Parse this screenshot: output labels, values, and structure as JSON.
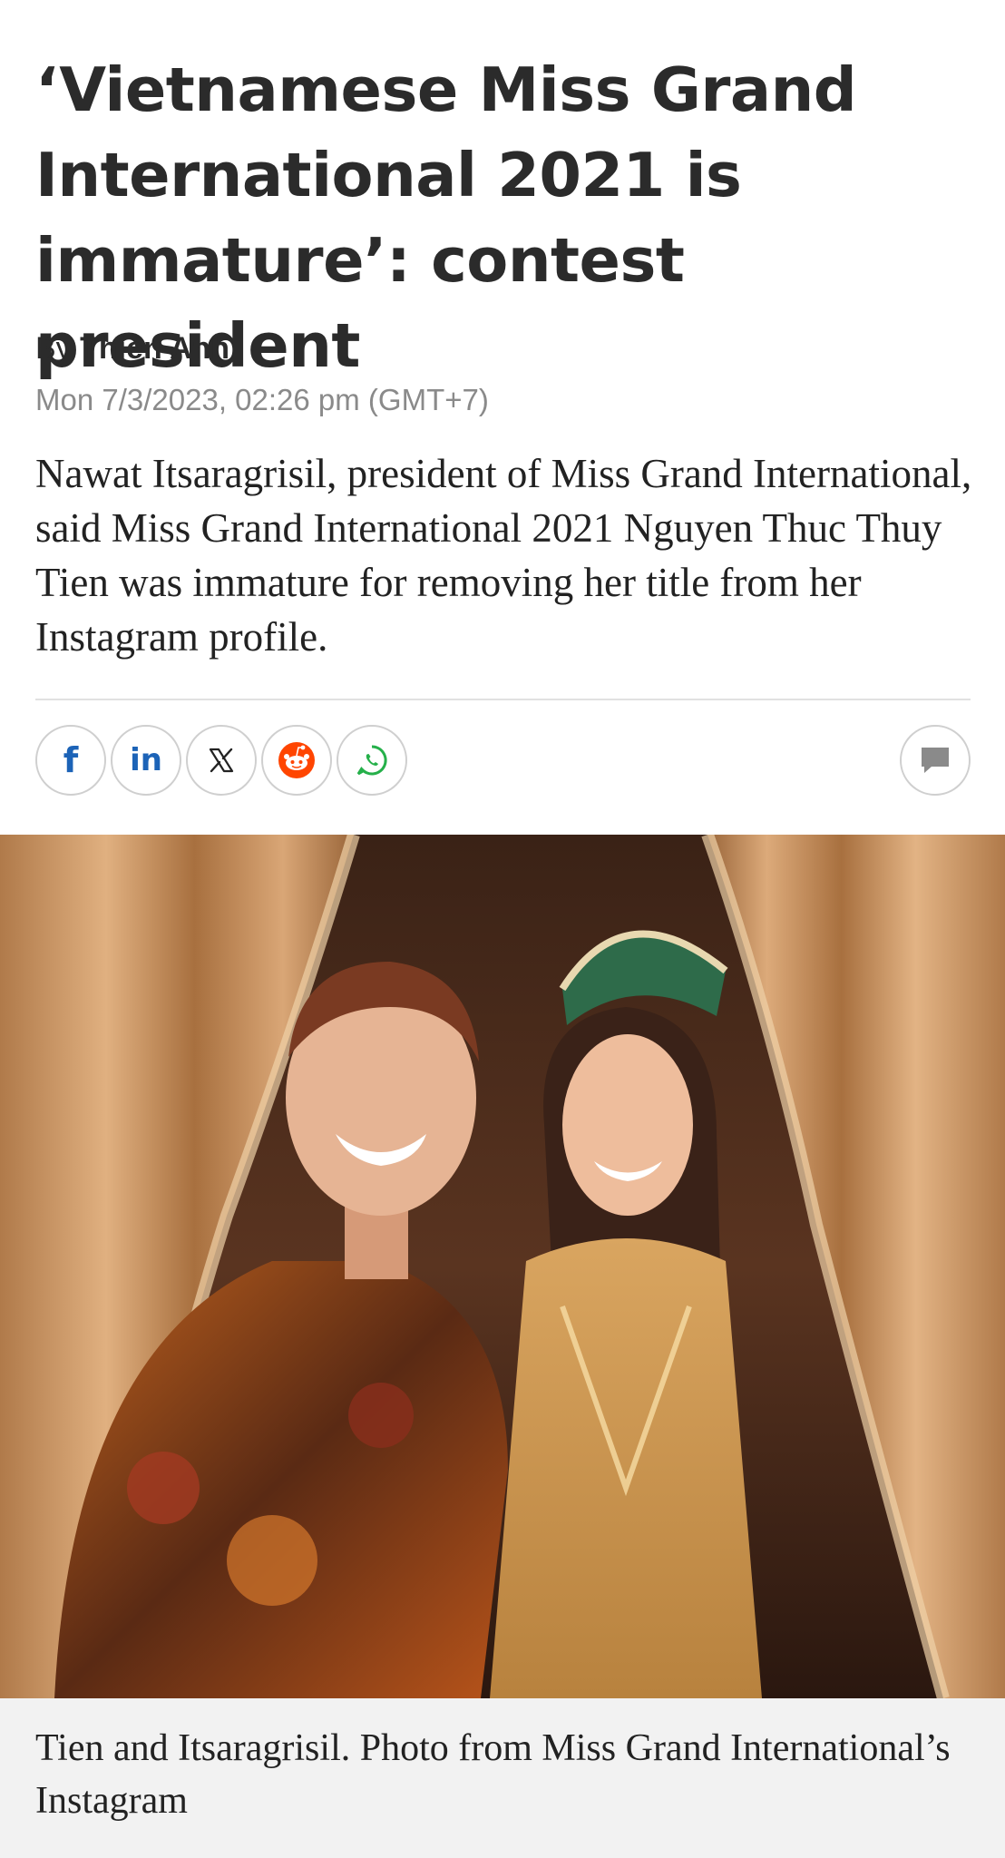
{
  "article": {
    "headline": "‘Vietnamese Miss Grand International 2021 is immature’: contest president",
    "byline_prefix": "By",
    "author": "Thien Anh",
    "timestamp": "Mon 7/3/2023, 02:26 pm (GMT+7)",
    "lead": "Nawat Itsaragrisil, president of Miss Grand International, said Miss Grand International 2021 Nguyen Thuc Thuy Tien was immature for removing her title from her Instagram profile."
  },
  "share": {
    "icons": [
      "facebook-icon",
      "linkedin-icon",
      "x-icon",
      "reddit-icon",
      "whatsapp-icon",
      "comment-icon"
    ],
    "linkedin_text": "in",
    "facebook_text": "f",
    "colors": {
      "facebook": "#1c63b7",
      "linkedin": "#1c63b7",
      "x": "#222222",
      "reddit": "#ff4500",
      "whatsapp": "#25b04a",
      "comment": "#8a8a8a"
    }
  },
  "photo": {
    "caption": "Tien and Itsaragrisil. Photo from Miss Grand International’s Instagram"
  }
}
